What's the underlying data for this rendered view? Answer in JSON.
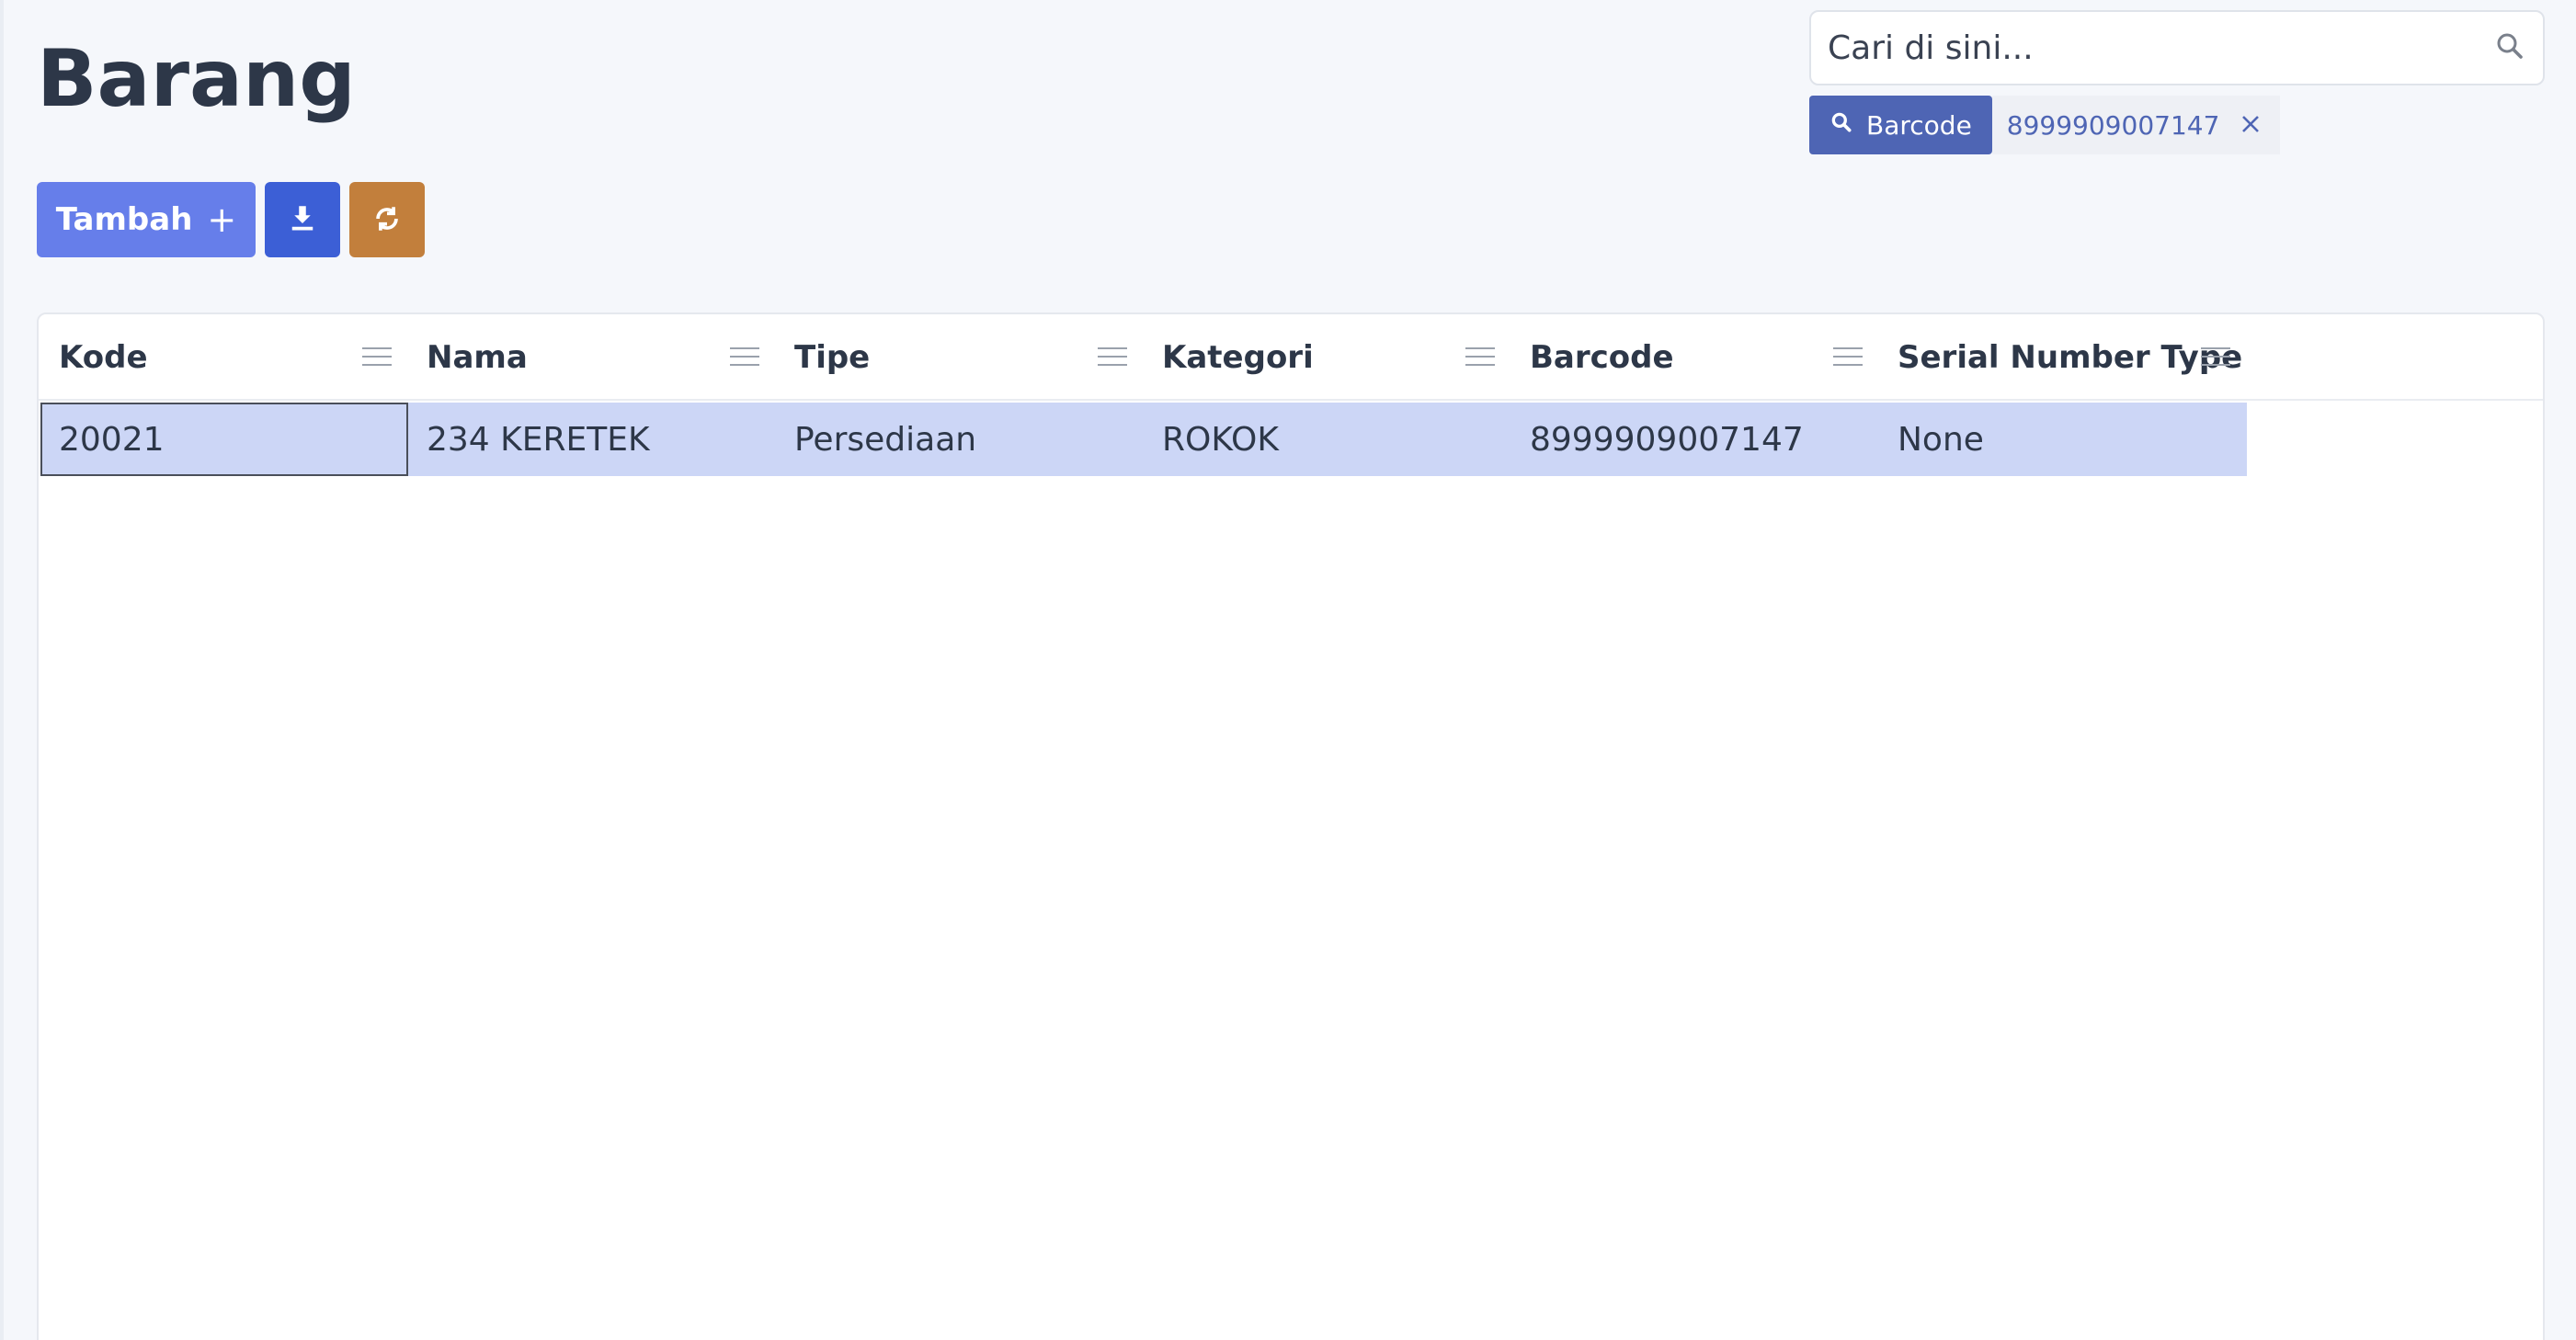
{
  "page": {
    "title": "Barang"
  },
  "toolbar": {
    "add_label": "Tambah",
    "add_plus": "+"
  },
  "search": {
    "placeholder": "Cari di sini...",
    "filter": {
      "field": "Barcode",
      "value": "8999909007147"
    }
  },
  "table": {
    "columns": [
      "Kode",
      "Nama",
      "Tipe",
      "Kategori",
      "Barcode",
      "Serial Number Type"
    ],
    "rows": [
      {
        "kode": "20021",
        "nama": "234 KERETEK",
        "tipe": "Persediaan",
        "kategori": "ROKOK",
        "barcode": "8999909007147",
        "serial_number_type": "None"
      }
    ]
  },
  "colors": {
    "primary": "#667eea",
    "download": "#3c5fd6",
    "sync": "#c27f3c",
    "filter_tag": "#4e65b4",
    "selected_row": "#ccd6f6"
  },
  "icons": {
    "search": "search-icon",
    "download": "download-icon",
    "sync": "sync-icon",
    "column_menu": "column-menu-icon",
    "clear": "close-icon"
  }
}
